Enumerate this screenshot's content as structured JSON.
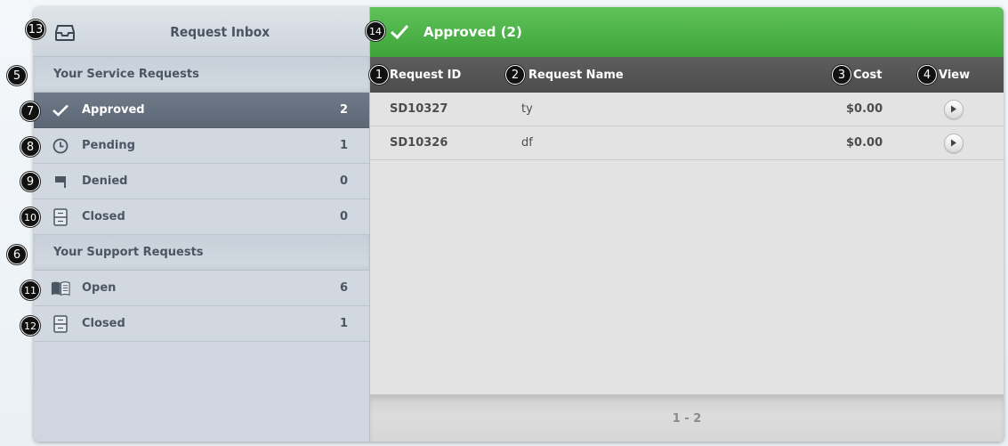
{
  "sidebar": {
    "title": "Request Inbox",
    "service_section": "Your Service Requests",
    "support_section": "Your Support Requests",
    "service_items": [
      {
        "label": "Approved",
        "count": "2",
        "icon": "checkmark-icon",
        "active": true
      },
      {
        "label": "Pending",
        "count": "1",
        "icon": "clock-icon"
      },
      {
        "label": "Denied",
        "count": "0",
        "icon": "flag-icon"
      },
      {
        "label": "Closed",
        "count": "0",
        "icon": "cabinet-icon"
      }
    ],
    "support_items": [
      {
        "label": "Open",
        "count": "6",
        "icon": "open-book-icon"
      },
      {
        "label": "Closed",
        "count": "1",
        "icon": "cabinet-icon"
      }
    ]
  },
  "main": {
    "title": "Approved (2)",
    "columns": {
      "id": "Request ID",
      "name": "Request Name",
      "cost": "Cost",
      "view": "View"
    },
    "rows": [
      {
        "id": "SD10327",
        "name": "ty",
        "cost": "$0.00"
      },
      {
        "id": "SD10326",
        "name": "df",
        "cost": "$0.00"
      }
    ],
    "pagination": "1 - 2"
  },
  "markers": [
    "1",
    "2",
    "3",
    "4",
    "5",
    "6",
    "7",
    "8",
    "9",
    "10",
    "11",
    "12",
    "13",
    "14"
  ],
  "colors": {
    "accent_green": "#4cb348",
    "active_item": "#65707e",
    "table_header": "#555555"
  }
}
